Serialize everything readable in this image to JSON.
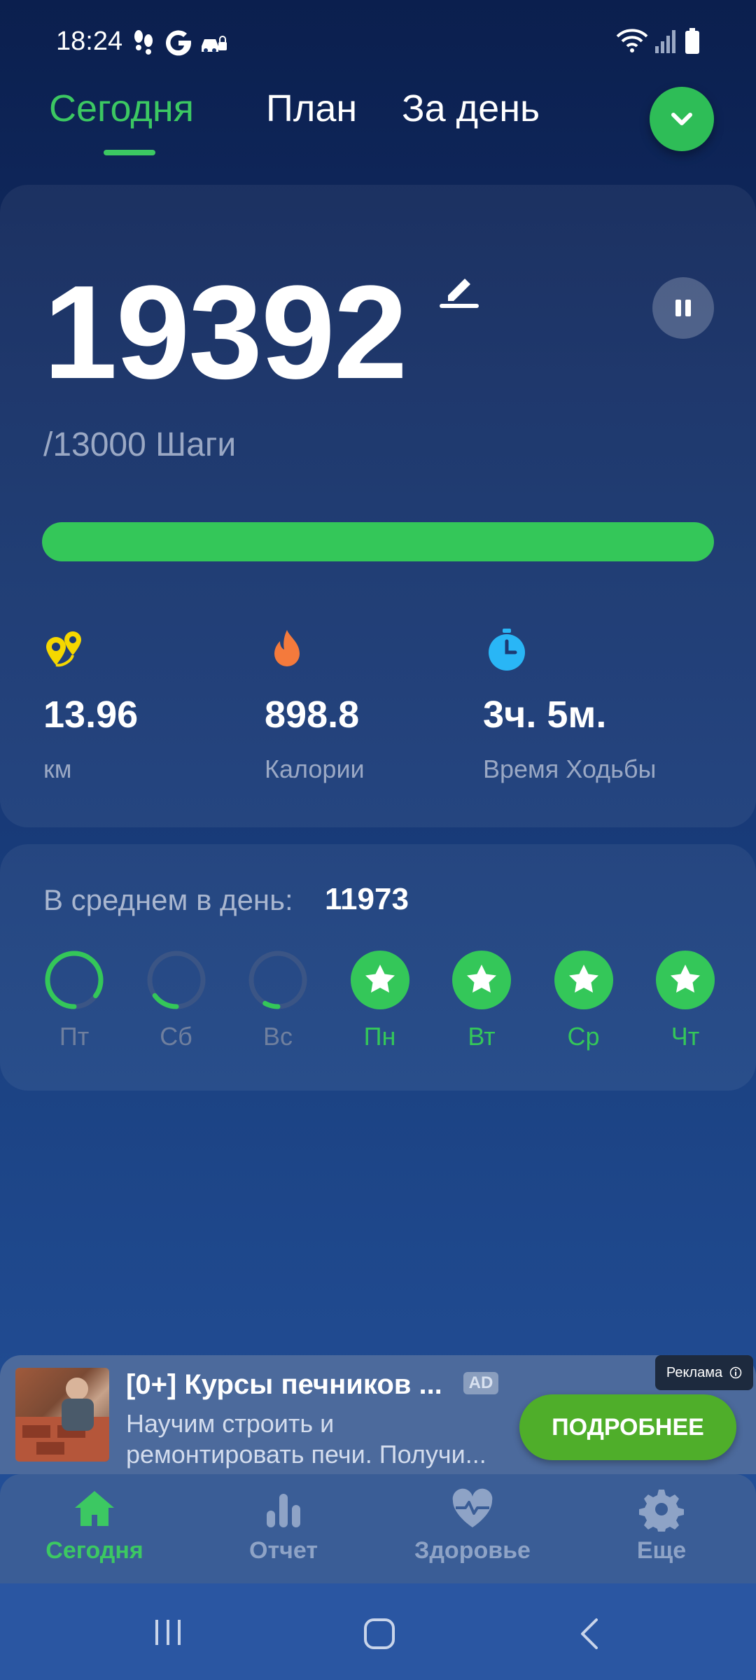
{
  "status_bar": {
    "time": "18:24"
  },
  "tabs": [
    {
      "label": "Сегодня",
      "active": true
    },
    {
      "label": "План",
      "active": false
    },
    {
      "label": "За день",
      "active": false
    }
  ],
  "steps": {
    "value": "19392",
    "goal_text": "/13000 Шаги",
    "progress_fraction": 1.0
  },
  "stats": [
    {
      "value": "13.96",
      "label": "км",
      "icon": "location-pins-icon"
    },
    {
      "value": "898.8",
      "label": "Калории",
      "icon": "flame-icon"
    },
    {
      "value": "3ч. 5м.",
      "label": "Время Ходьбы",
      "icon": "stopwatch-icon"
    }
  ],
  "week": {
    "avg_label": "В среднем в день:",
    "avg_value": "11973",
    "days": [
      {
        "label": "Пт",
        "progress": 0.85,
        "goal_met": false
      },
      {
        "label": "Сб",
        "progress": 0.15,
        "goal_met": false
      },
      {
        "label": "Вс",
        "progress": 0.08,
        "goal_met": false
      },
      {
        "label": "Пн",
        "progress": 1.0,
        "goal_met": true
      },
      {
        "label": "Вт",
        "progress": 1.0,
        "goal_met": true
      },
      {
        "label": "Ср",
        "progress": 1.0,
        "goal_met": true
      },
      {
        "label": "Чт",
        "progress": 1.0,
        "goal_met": true
      }
    ]
  },
  "ad": {
    "title": "[0+] Курсы печников ...",
    "badge": "AD",
    "description": "Научим строить и ремонтировать печи. Получи...",
    "cta": "ПОДРОБНЕЕ",
    "tag": "Реклама"
  },
  "bottom_nav": [
    {
      "label": "Сегодня",
      "icon": "home-icon",
      "active": true
    },
    {
      "label": "Отчет",
      "icon": "bar-chart-icon",
      "active": false
    },
    {
      "label": "Здоровье",
      "icon": "heart-pulse-icon",
      "active": false
    },
    {
      "label": "Еще",
      "icon": "gear-icon",
      "active": false
    }
  ],
  "colors": {
    "accent": "#34c759",
    "track": "#3b5585",
    "muted": "#9aa8c4"
  }
}
